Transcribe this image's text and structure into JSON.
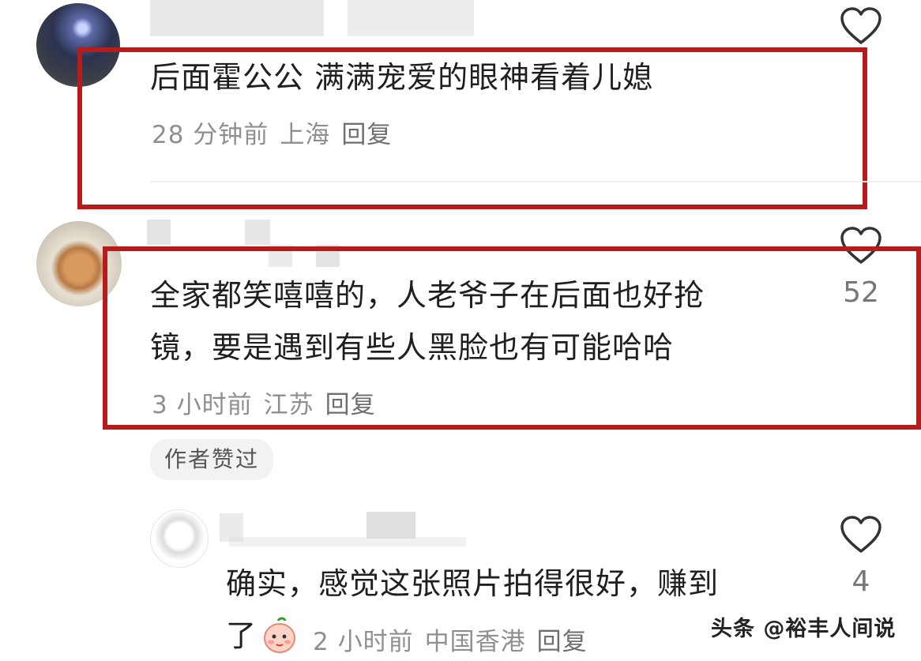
{
  "comments": [
    {
      "text": "后面霍公公 满满宠爱的眼神看着儿媳",
      "time": "28 分钟前",
      "location": "上海",
      "reply": "回复"
    },
    {
      "text_line1": "全家都笑嘻嘻的，人老爷子在后面也好抢",
      "text_line2": "镜，要是遇到有些人黑脸也有可能哈哈",
      "time": "3 小时前",
      "location": "江苏",
      "reply": "回复",
      "likes": "52",
      "badge": "作者赞过"
    }
  ],
  "reply_comment": {
    "text_line1": "确实，感觉这张照片拍得很好，赚到",
    "text_line2": "了",
    "time": "2 小时前",
    "location": "中国香港",
    "reply": "回复",
    "likes": "4"
  },
  "watermark": "头条 @裕丰人间说",
  "colors": {
    "highlight_border": "#b71c1c",
    "meta_text": "#8f8f8f"
  },
  "icons": [
    "heart-outline-icon",
    "blush-emoji-icon"
  ]
}
